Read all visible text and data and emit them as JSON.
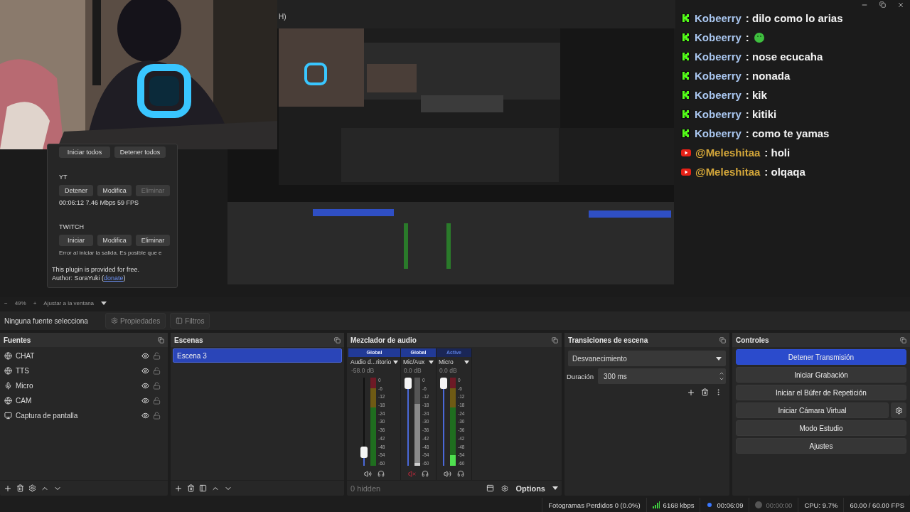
{
  "preview": {
    "title_fragment": "H)",
    "plugin": {
      "top_buttons": [
        "Iniciar todos",
        "Detener todos"
      ],
      "outputs": [
        {
          "name": "YT",
          "buttons": [
            {
              "label": "Detener",
              "disabled": false
            },
            {
              "label": "Modifica",
              "disabled": false
            },
            {
              "label": "Eliminar",
              "disabled": true
            }
          ],
          "stats": "00:06:12 7.46 Mbps 59 FPS"
        },
        {
          "name": "TWITCH",
          "buttons": [
            {
              "label": "Iniciar",
              "disabled": false
            },
            {
              "label": "Modifica",
              "disabled": false
            },
            {
              "label": "Eliminar",
              "disabled": false
            }
          ],
          "error": "Error al iniciar la salida. Es posible que e"
        }
      ],
      "note": "This plugin is provided for free.",
      "author": "Author: SoraYuki (",
      "link": "donate",
      "author_end": ")"
    },
    "chat": [
      {
        "kind": "kick",
        "user": "Kobeerry",
        "color": "#a9c6ef",
        "text": ": dilo como lo arias",
        "emote": false
      },
      {
        "kind": "kick",
        "user": "Kobeerry",
        "color": "#a9c6ef",
        "text": ":",
        "emote": true
      },
      {
        "kind": "kick",
        "user": "Kobeerry",
        "color": "#a9c6ef",
        "text": ": nose ecucaha",
        "emote": false
      },
      {
        "kind": "kick",
        "user": "Kobeerry",
        "color": "#a9c6ef",
        "text": ": nonada",
        "emote": false
      },
      {
        "kind": "kick",
        "user": "Kobeerry",
        "color": "#a9c6ef",
        "text": ": kik",
        "emote": false
      },
      {
        "kind": "kick",
        "user": "Kobeerry",
        "color": "#a9c6ef",
        "text": ": kitiki",
        "emote": false
      },
      {
        "kind": "kick",
        "user": "Kobeerry",
        "color": "#a9c6ef",
        "text": ": como te yamas",
        "emote": false
      },
      {
        "kind": "youtube",
        "user": "@Meleshitaa",
        "color": "#d4a73a",
        "text": ": holi",
        "emote": false
      },
      {
        "kind": "youtube",
        "user": "@Meleshitaa",
        "color": "#d4a73a",
        "text": ": olqaqa",
        "emote": false
      }
    ]
  },
  "zoom": {
    "minus": "−",
    "value": "49%",
    "plus": "+",
    "fit": "Ajustar a la ventana"
  },
  "source_bar": {
    "selection": "Ninguna fuente selecciona",
    "buttons": [
      {
        "label": "Propiedades",
        "kind": "properties",
        "disabled": true
      },
      {
        "label": "Filtros",
        "kind": "filters",
        "disabled": true
      }
    ]
  },
  "sources": {
    "title": "Fuentes",
    "items": [
      {
        "name": "CHAT",
        "kind": "browser",
        "visible": true,
        "locked": false
      },
      {
        "name": "TTS",
        "kind": "browser",
        "visible": true,
        "locked": false
      },
      {
        "name": "Micro",
        "kind": "mic",
        "visible": true,
        "locked": false
      },
      {
        "name": "CAM",
        "kind": "browser",
        "visible": true,
        "locked": false
      },
      {
        "name": "Captura de pantalla",
        "kind": "display",
        "visible": true,
        "locked": false
      }
    ]
  },
  "scenes": {
    "title": "Escenas",
    "items": [
      {
        "name": "Escena 3",
        "selected": true
      }
    ]
  },
  "mixer": {
    "title": "Mezclador de audio",
    "hidden": "0 hidden",
    "options": "Options",
    "channels": [
      {
        "header": "Global",
        "kind": "global",
        "name": "Audio d...ritorio",
        "db": "-58.0 dB",
        "muted": false,
        "fader": {
          "level": 0.1
        },
        "scale": [
          "0",
          "-6",
          "-12",
          "-18",
          "-24",
          "-30",
          "-36",
          "-42",
          "-48",
          "-54",
          "-60"
        ]
      },
      {
        "header": "Global",
        "kind": "global",
        "name": "Mic/Aux",
        "db": "0.0 dB",
        "muted": true,
        "fader": {
          "level": 1
        },
        "meter": {
          "level": 0.03
        },
        "scale": [
          "0",
          "-6",
          "-12",
          "-18",
          "-24",
          "-30",
          "-36",
          "-42",
          "-48",
          "-54",
          "-60"
        ]
      },
      {
        "header": "Active",
        "kind": "active",
        "name": "Micro",
        "db": "0.0 dB",
        "muted": false,
        "fader": {
          "level": 1
        },
        "meter": {
          "level": 0.12
        },
        "scale": [
          "0",
          "-6",
          "-12",
          "-18",
          "-24",
          "-30",
          "-36",
          "-42",
          "-48",
          "-54",
          "-60"
        ]
      }
    ]
  },
  "transitions": {
    "title": "Transiciones de escena",
    "selected": "Desvanecimiento",
    "duration_label": "Duración",
    "duration": "300 ms"
  },
  "controls": {
    "title": "Controles",
    "buttons": [
      {
        "label": "Detener Transmisión",
        "active": true,
        "settings": false
      },
      {
        "label": "Iniciar Grabación",
        "active": false,
        "settings": false
      },
      {
        "label": "Iniciar el Búfer de Repetición",
        "active": false,
        "settings": false
      },
      {
        "label": "Iniciar Cámara Virtual",
        "active": false,
        "settings": true
      },
      {
        "label": "Modo Estudio",
        "active": false,
        "settings": false
      },
      {
        "label": "Ajustes",
        "active": false,
        "settings": false
      }
    ]
  },
  "status": {
    "dropped": "Fotogramas Perdidos 0 (0.0%)",
    "bitrate": "6168 kbps",
    "stream_time": "00:06:09",
    "streaming": true,
    "rec_time": "00:00:00",
    "recording": false,
    "cpu": "CPU: 9.7%",
    "fps": "60.00 / 60.00 FPS"
  }
}
